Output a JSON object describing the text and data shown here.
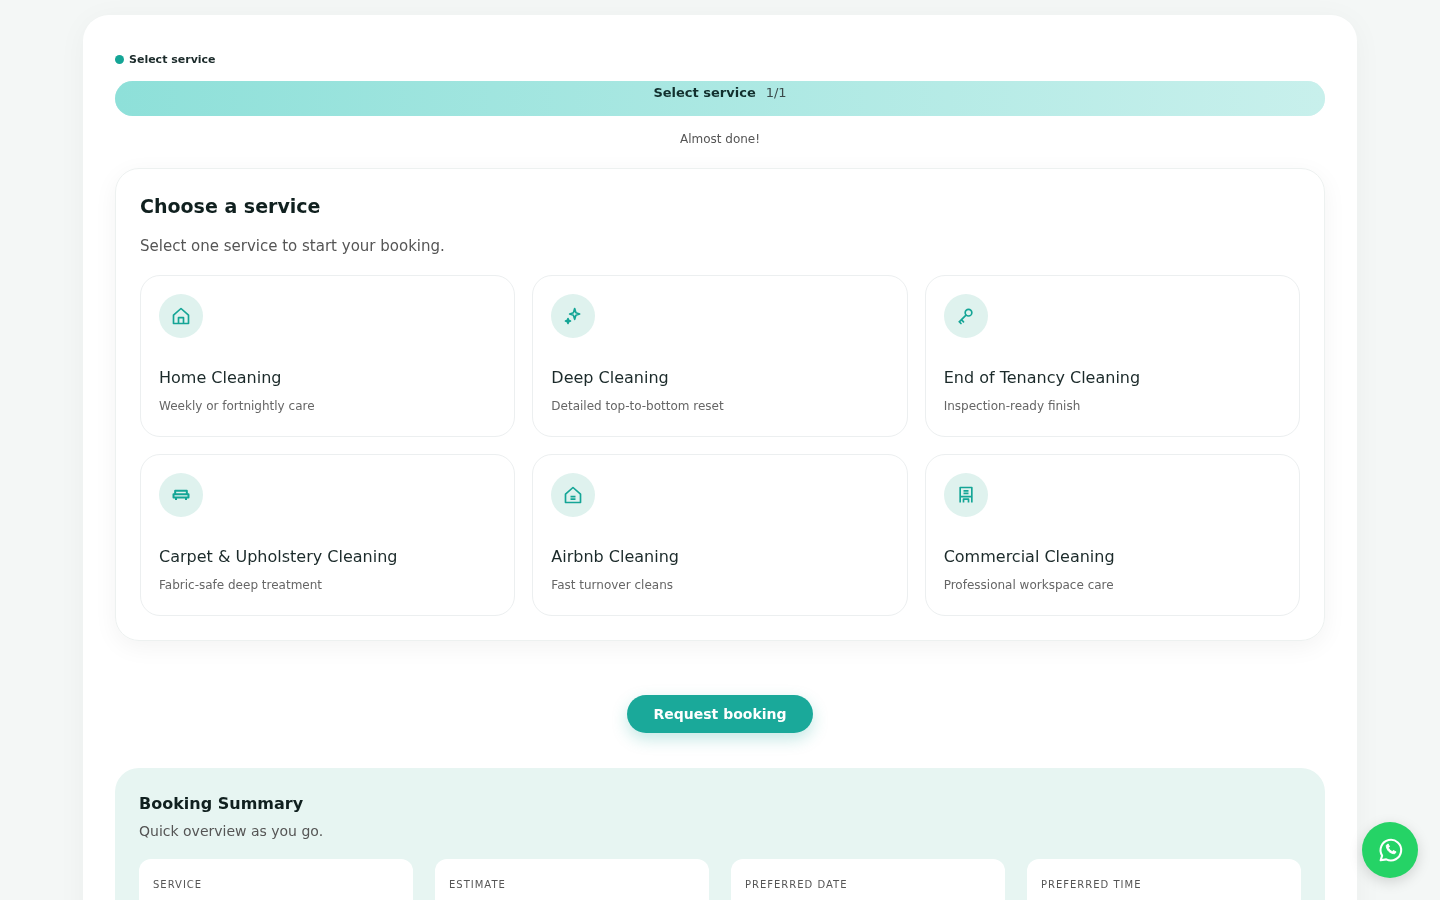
{
  "step_indicator": {
    "label": "Select service",
    "color": "#14a596"
  },
  "progress": {
    "label": "Select service",
    "count": "1/1",
    "level": 1,
    "caption": "Almost done!"
  },
  "service_panel": {
    "title": "Choose a service",
    "subtitle": "Select one service to start your booking.",
    "services": [
      {
        "kind": "home",
        "name": "Home Cleaning",
        "description": "Weekly or fortnightly care",
        "selected": false
      },
      {
        "kind": "sparkle",
        "name": "Deep Cleaning",
        "description": "Detailed top-to-bottom reset",
        "selected": false
      },
      {
        "kind": "key",
        "name": "End of Tenancy Cleaning",
        "description": "Inspection-ready finish",
        "selected": false
      },
      {
        "kind": "sofa",
        "name": "Carpet & Upholstery Cleaning",
        "description": "Fabric-safe deep treatment",
        "selected": false
      },
      {
        "kind": "rental",
        "name": "Airbnb Cleaning",
        "description": "Fast turnover cleans",
        "selected": false
      },
      {
        "kind": "building",
        "name": "Commercial Cleaning",
        "description": "Professional workspace care",
        "selected": false
      }
    ]
  },
  "request_button": "Request booking",
  "summary": {
    "title": "Booking Summary",
    "subtitle": "Quick overview as you go.",
    "fields": [
      "SERVICE",
      "ESTIMATE",
      "PREFERRED DATE",
      "PREFERRED TIME"
    ]
  }
}
